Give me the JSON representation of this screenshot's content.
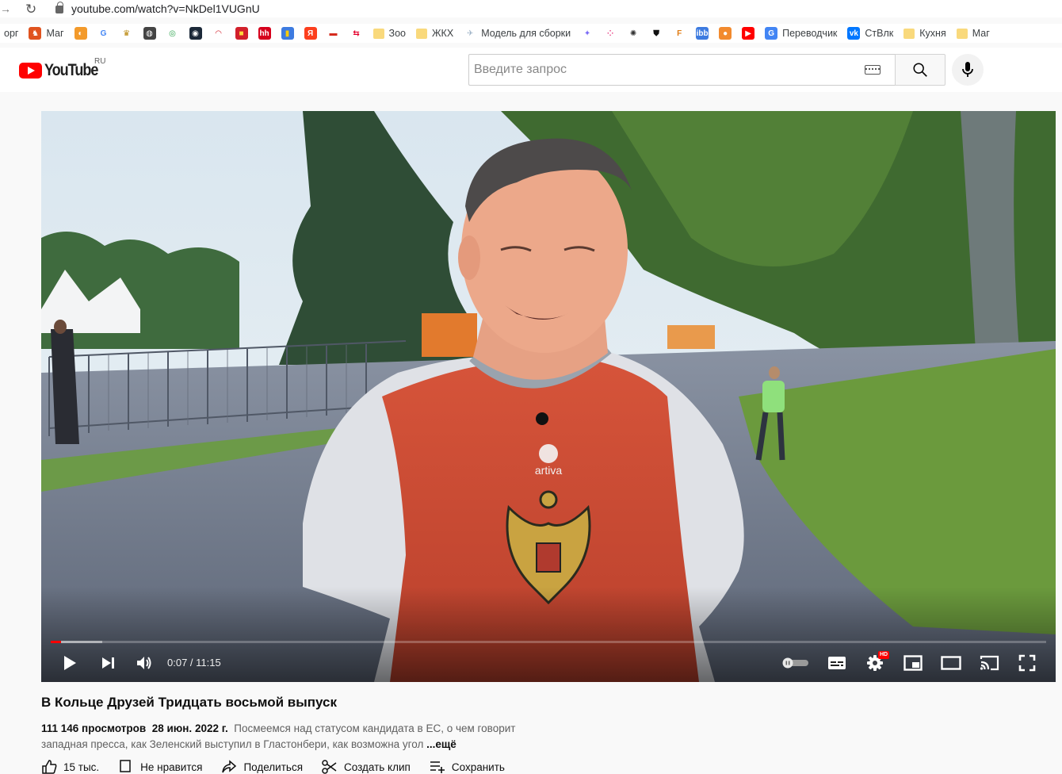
{
  "browser": {
    "url": "youtube.com/watch?v=NkDel1VUGnU",
    "bookmarks": [
      {
        "label": "орг",
        "icon": "cut-off-icon"
      },
      {
        "label": "Маг",
        "icon": "shop-icon"
      },
      {
        "label": "",
        "icon": "orange-swirl-icon"
      },
      {
        "label": "",
        "icon": "google-icon"
      },
      {
        "label": "",
        "icon": "emblem-icon"
      },
      {
        "label": "",
        "icon": "globe-icon"
      },
      {
        "label": "",
        "icon": "green-circle-icon"
      },
      {
        "label": "",
        "icon": "steam-icon"
      },
      {
        "label": "",
        "icon": "red-arc-icon"
      },
      {
        "label": "",
        "icon": "red-square-icon"
      },
      {
        "label": "",
        "icon": "hh-icon"
      },
      {
        "label": "",
        "icon": "bag-icon"
      },
      {
        "label": "",
        "icon": "yandex-icon"
      },
      {
        "label": "",
        "icon": "flag-icon"
      },
      {
        "label": "",
        "icon": "arrows-icon"
      },
      {
        "label": "Зоо",
        "icon": "folder-icon"
      },
      {
        "label": "ЖКХ",
        "icon": "folder-icon"
      },
      {
        "label": "Модель для сборки",
        "icon": "model-icon"
      },
      {
        "label": "",
        "icon": "sparkle-icon"
      },
      {
        "label": "",
        "icon": "dots-icon"
      },
      {
        "label": "",
        "icon": "openai-icon"
      },
      {
        "label": "",
        "icon": "shield-icon"
      },
      {
        "label": "",
        "icon": "bracket-f-icon"
      },
      {
        "label": "",
        "icon": "ibb-icon"
      },
      {
        "label": "",
        "icon": "pie-icon"
      },
      {
        "label": "",
        "icon": "youtube-icon"
      },
      {
        "label": "Переводчик",
        "icon": "translate-icon"
      },
      {
        "label": "СтВлк",
        "icon": "vk-icon"
      },
      {
        "label": "Кухня",
        "icon": "folder-icon"
      },
      {
        "label": "Маг",
        "icon": "folder-icon"
      }
    ]
  },
  "header": {
    "logo_text": "YouTube",
    "region": "RU",
    "search_placeholder": "Введите запрос"
  },
  "player": {
    "time": "0:07 / 11:15",
    "progress_played_fraction": 0.0104,
    "progress_buffered_fraction": 0.052,
    "hd_badge": "HD",
    "shirt_brand": "artiva"
  },
  "video": {
    "title": "В Кольце Друзей Тридцать восьмой выпуск",
    "views": "111 146 просмотров",
    "date": "28 июн. 2022 г.",
    "description": "Посмеемся над статусом кандидата в ЕС, о чем говорит западная пресса, как Зеленский выступил в Гластонбери, как возможна угол",
    "more": "...ещё"
  },
  "actions": {
    "like": "15 тыс.",
    "dislike": "Не нравится",
    "share": "Поделиться",
    "clip": "Создать клип",
    "save": "Сохранить"
  },
  "colors": {
    "brand_red": "#ff0000",
    "progress_red": "#ff0000"
  }
}
